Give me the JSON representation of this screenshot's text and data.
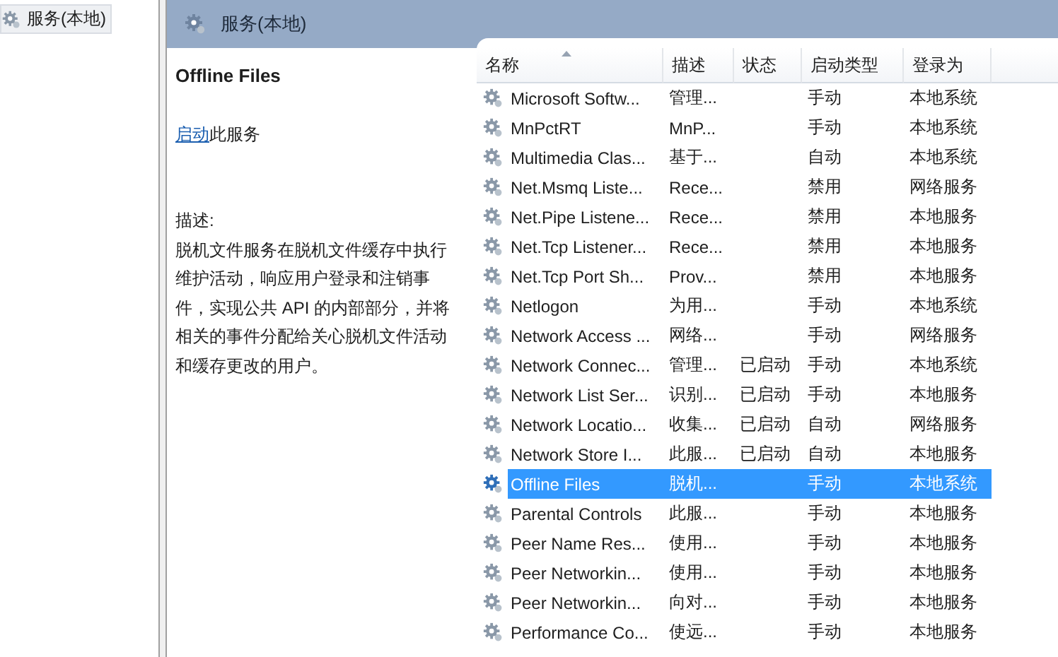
{
  "tree": {
    "items": [
      {
        "label": "服务(本地)",
        "selected": true
      }
    ]
  },
  "pane": {
    "title": "服务(本地)"
  },
  "details": {
    "service_name": "Offline Files",
    "action_link": "启动",
    "action_rest": "此服务",
    "description_label": "描述:",
    "description": "脱机文件服务在脱机文件缓存中执行维护活动，响应用户登录和注销事件，实现公共 API 的内部部分，并将相关的事件分配给关心脱机文件活动和缓存更改的用户。"
  },
  "table": {
    "columns": [
      {
        "label": "名称",
        "sorted": true
      },
      {
        "label": "描述",
        "sorted": false
      },
      {
        "label": "状态",
        "sorted": false
      },
      {
        "label": "启动类型",
        "sorted": false
      },
      {
        "label": "登录为",
        "sorted": false
      }
    ],
    "rows": [
      {
        "name": "Microsoft Softw...",
        "description": "管理...",
        "status": "",
        "startup": "手动",
        "logon": "本地系统",
        "selected": false
      },
      {
        "name": "MnPctRT",
        "description": "MnP...",
        "status": "",
        "startup": "手动",
        "logon": "本地系统",
        "selected": false
      },
      {
        "name": "Multimedia Clas...",
        "description": "基于...",
        "status": "",
        "startup": "自动",
        "logon": "本地系统",
        "selected": false
      },
      {
        "name": "Net.Msmq Liste...",
        "description": "Rece...",
        "status": "",
        "startup": "禁用",
        "logon": "网络服务",
        "selected": false
      },
      {
        "name": "Net.Pipe Listene...",
        "description": "Rece...",
        "status": "",
        "startup": "禁用",
        "logon": "本地服务",
        "selected": false
      },
      {
        "name": "Net.Tcp Listener...",
        "description": "Rece...",
        "status": "",
        "startup": "禁用",
        "logon": "本地服务",
        "selected": false
      },
      {
        "name": "Net.Tcp Port Sh...",
        "description": "Prov...",
        "status": "",
        "startup": "禁用",
        "logon": "本地服务",
        "selected": false
      },
      {
        "name": "Netlogon",
        "description": "为用...",
        "status": "",
        "startup": "手动",
        "logon": "本地系统",
        "selected": false
      },
      {
        "name": "Network Access ...",
        "description": "网络...",
        "status": "",
        "startup": "手动",
        "logon": "网络服务",
        "selected": false
      },
      {
        "name": "Network Connec...",
        "description": "管理...",
        "status": "已启动",
        "startup": "手动",
        "logon": "本地系统",
        "selected": false
      },
      {
        "name": "Network List Ser...",
        "description": "识别...",
        "status": "已启动",
        "startup": "手动",
        "logon": "本地服务",
        "selected": false
      },
      {
        "name": "Network Locatio...",
        "description": "收集...",
        "status": "已启动",
        "startup": "自动",
        "logon": "网络服务",
        "selected": false
      },
      {
        "name": "Network Store I...",
        "description": "此服...",
        "status": "已启动",
        "startup": "自动",
        "logon": "本地服务",
        "selected": false
      },
      {
        "name": "Offline Files",
        "description": "脱机...",
        "status": "",
        "startup": "手动",
        "logon": "本地系统",
        "selected": true
      },
      {
        "name": "Parental Controls",
        "description": "此服...",
        "status": "",
        "startup": "手动",
        "logon": "本地服务",
        "selected": false
      },
      {
        "name": "Peer Name Res...",
        "description": "使用...",
        "status": "",
        "startup": "手动",
        "logon": "本地服务",
        "selected": false
      },
      {
        "name": "Peer Networkin...",
        "description": "使用...",
        "status": "",
        "startup": "手动",
        "logon": "本地服务",
        "selected": false
      },
      {
        "name": "Peer Networkin...",
        "description": "向对...",
        "status": "",
        "startup": "手动",
        "logon": "本地服务",
        "selected": false
      },
      {
        "name": "Performance Co...",
        "description": "使远...",
        "status": "",
        "startup": "手动",
        "logon": "本地服务",
        "selected": false
      }
    ]
  }
}
